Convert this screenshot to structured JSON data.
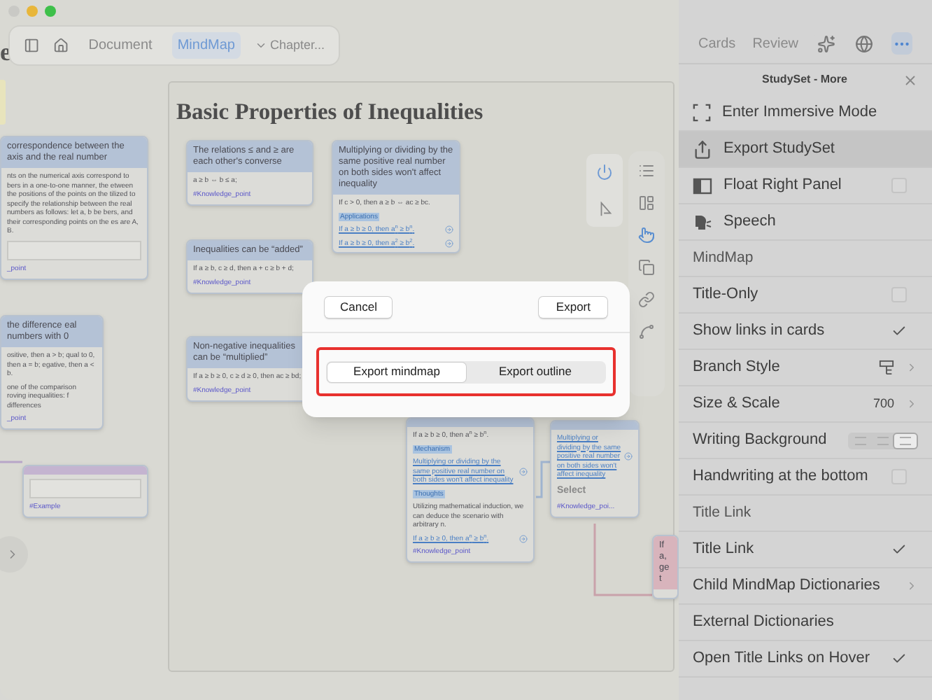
{
  "toolbar": {
    "tabs": [
      {
        "label": "Document",
        "selected": false
      },
      {
        "label": "MindMap",
        "selected": true
      }
    ],
    "chapter": "Chapter..."
  },
  "canvas": {
    "edge_title": "e",
    "title": "Basic Properties of Inequalities",
    "cards": [
      {
        "color": "#b4c2d6",
        "title": "correspondence between the axis and the real number",
        "body": [
          {
            "kind": "text",
            "text": "nts on the numerical axis correspond to bers in a one-to-one manner, the etween the positions of the points on the tilized to specify the relationship between the real numbers as follows: let a, b be bers, and their corresponding points on the es are A, B."
          },
          {
            "kind": "figure"
          }
        ],
        "tag": "_point"
      },
      {
        "color": "#b4c2d6",
        "title": "the difference eal numbers with 0",
        "body": [
          {
            "kind": "text",
            "text": "ositive, then a > b; qual to 0, then a = b; egative, then a < b."
          },
          {
            "kind": "text",
            "text": "one of the comparison roving inequalities: f differences"
          }
        ],
        "tag": "_point"
      },
      {
        "color": "#c4b4d0",
        "body": [
          {
            "kind": "figure"
          }
        ],
        "tag": "#Example"
      },
      {
        "color": "#b4c2d6",
        "title": "The relations ≤ and ≥ are each other's converse",
        "body": [
          {
            "kind": "text",
            "text": "a ≥ b ⇔ b ≤ a;"
          }
        ],
        "tag": "#Knowledge_point"
      },
      {
        "color": "#b4c2d6",
        "title": "Inequalities can be “added”",
        "body": [
          {
            "kind": "text",
            "text": "If a ≥ b, c ≥ d, then a + c ≥ b + d;"
          }
        ],
        "tag": "#Knowledge_point"
      },
      {
        "color": "#b4c2d6",
        "title": "Non-negative inequalities can be “multiplied”",
        "body": [
          {
            "kind": "text",
            "text": "If a ≥ b ≥ 0, c ≥ d ≥ 0, then ac ≥ bd;"
          }
        ],
        "tag": "#Knowledge_point"
      },
      {
        "color": "#b4c2d6",
        "title": "Multiplying or dividing by the same positive real number on both sides won't affect inequality",
        "body": [
          {
            "kind": "text",
            "text": "If c > 0, then a ≥ b ⇔ ac ≥ bc."
          },
          {
            "kind": "heading",
            "text": "Applications"
          },
          {
            "kind": "link",
            "text": "If a ≥ b ≥ 0, then a$^{n}$ ≥ b$^{n}$."
          },
          {
            "kind": "link",
            "text": "If a ≥ b ≥ 0, then a$^{2}$ ≥ b$^{2}$."
          }
        ]
      },
      {
        "color": "#b4c2d6",
        "body": [
          {
            "kind": "text",
            "text": "If a ≥ b ≥ 0, then a$^{n}$ ≥ b$^{n}$."
          },
          {
            "kind": "heading",
            "text": "Mechanism"
          },
          {
            "kind": "link",
            "text": "Multiplying or dividing by the same positive real number on both sides won't affect inequality"
          },
          {
            "kind": "heading",
            "text": "Thoughts"
          },
          {
            "kind": "text",
            "text": "Utilizing mathematical induction, we can deduce the scenario with arbitrary n."
          },
          {
            "kind": "link",
            "text": "If a ≥ b ≥ 0, then a$^{n}$ ≥ b$^{n}$."
          }
        ],
        "tag": "#Knowledge_point"
      },
      {
        "color": "#b4c2d6",
        "body": [
          {
            "kind": "link",
            "text": "Multiplying or dividing by the same positive real number on both sides won't affect inequality"
          },
          {
            "kind": "select",
            "text": "Select"
          }
        ],
        "tag": "#Knowledge_poi..."
      },
      {
        "color": "#d8b4bc",
        "title": "If a, get"
      }
    ]
  },
  "panel": {
    "tabs": [
      {
        "label": "Cards",
        "selected": false
      },
      {
        "label": "Review",
        "selected": false
      }
    ],
    "tool_buttons": [
      {
        "kind": "sparkle",
        "selected": false
      },
      {
        "kind": "help",
        "selected": false
      },
      {
        "kind": "more",
        "selected": true
      }
    ],
    "title": "StudySet - More",
    "items": [
      {
        "kind": "action",
        "label": "Enter Immersive Mode",
        "selected": false
      },
      {
        "kind": "action",
        "label": "Export StudySet",
        "selected": true
      },
      {
        "kind": "checkbox",
        "label": "Float Right Panel",
        "checked": false
      },
      {
        "kind": "action",
        "label": "Speech",
        "selected": false
      },
      {
        "kind": "section",
        "label": "MindMap"
      },
      {
        "kind": "checkbox",
        "label": "Title-Only",
        "checked": false
      },
      {
        "kind": "checkbox",
        "label": "Show links in cards",
        "checked": true
      },
      {
        "kind": "branch",
        "label": "Branch Style"
      },
      {
        "kind": "value",
        "label": "Size & Scale",
        "value": "700"
      },
      {
        "kind": "segmented",
        "label": "Writing Background",
        "options": [
          {
            "selected": false
          },
          {
            "selected": false
          },
          {
            "selected": true
          }
        ]
      },
      {
        "kind": "checkbox",
        "label": "Handwriting at the bottom",
        "checked": false
      },
      {
        "kind": "section",
        "label": "Title Link"
      },
      {
        "kind": "checkbox",
        "label": "Title Link",
        "checked": true
      },
      {
        "kind": "chevron",
        "label": "Child MindMap Dictionaries"
      },
      {
        "kind": "plain",
        "label": "External Dictionaries"
      },
      {
        "kind": "checkbox",
        "label": "Open Title Links on Hover",
        "checked": true
      }
    ]
  },
  "dialog": {
    "cancel": "Cancel",
    "confirm": "Export",
    "options": [
      {
        "label": "Export mindmap",
        "selected": true
      },
      {
        "label": "Export outline",
        "selected": false
      }
    ]
  }
}
